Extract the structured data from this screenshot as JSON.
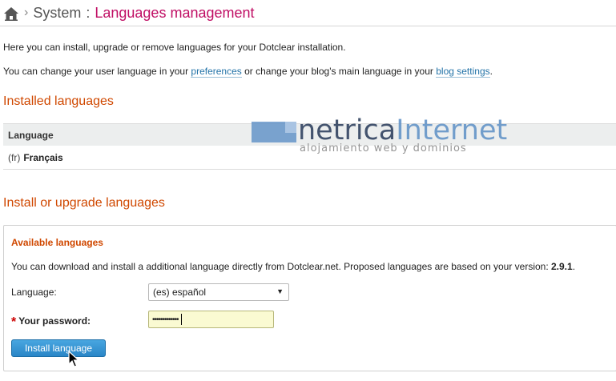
{
  "breadcrumb": {
    "separator": "›",
    "section": "System",
    "colon": ":",
    "title": "Languages management"
  },
  "intro": {
    "line1": "Here you can install, upgrade or remove languages for your Dotclear installation.",
    "line2_before": "You can change your user language in your ",
    "preferences_link": "preferences",
    "line2_middle": " or change your blog's main language in your ",
    "blog_settings_link": "blog settings",
    "line2_after": "."
  },
  "installed": {
    "heading": "Installed languages",
    "column_header": "Language",
    "rows": [
      {
        "code": "(fr)",
        "name": "Français"
      }
    ]
  },
  "install": {
    "heading": "Install or upgrade languages",
    "legend": "Available languages",
    "description_before": "You can download and install a additional language directly from Dotclear.net. Proposed languages are based on your version: ",
    "version": "2.9.1",
    "description_after": ".",
    "language_label": "Language:",
    "language_selected": "(es) español",
    "password_required_mark": "*",
    "password_label": "Your password:",
    "password_value": "•••••••••••••",
    "submit_label": "Install language"
  },
  "watermark": {
    "name_part1": "netrica",
    "name_part2": "Internet",
    "tagline": "alojamiento web y dominios"
  },
  "icons": {
    "home": "home-icon",
    "select_arrow": "chevron-down-icon",
    "cursor": "mouse-pointer-icon"
  },
  "colors": {
    "title": "#c00e64",
    "heading": "#d04800",
    "link": "#2373a8",
    "button": "#2a86c7",
    "password_bg": "#fafad2"
  }
}
